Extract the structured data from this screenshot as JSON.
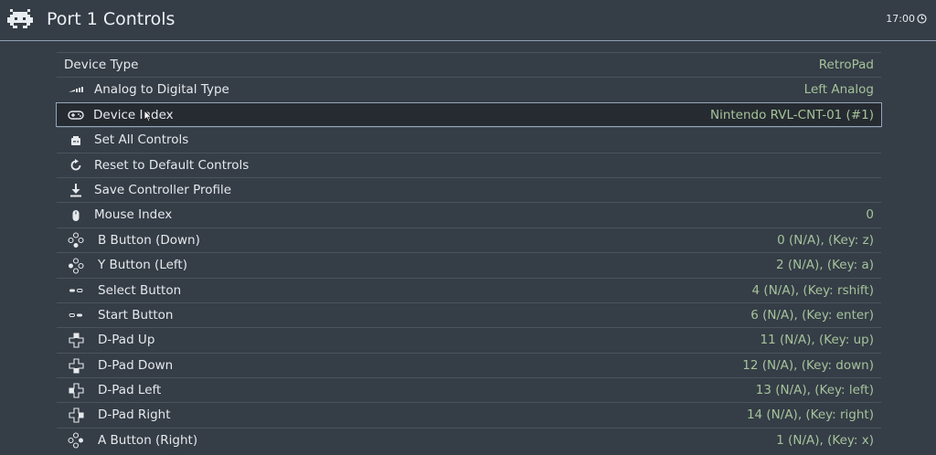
{
  "header": {
    "title": "Port 1 Controls",
    "time": "17:00",
    "logo_icon": "retroarch-invader-icon",
    "clock_icon": "clock-icon"
  },
  "colors": {
    "background": "#353d47",
    "selected_background": "#262b31",
    "selected_border": "#93a6bb",
    "value_text": "#a5c39a",
    "label_text": "#e6e9ec"
  },
  "menu": {
    "items": [
      {
        "label": "Device Type",
        "value": "RetroPad",
        "icon": "none"
      },
      {
        "label": "Analog to Digital Type",
        "value": "Left Analog",
        "icon": "analog-stick-icon"
      },
      {
        "label": "Device Index",
        "value": "Nintendo RVL-CNT-01 (#1)",
        "icon": "gamepad-icon",
        "selected": true
      },
      {
        "label": "Set All Controls",
        "value": "",
        "icon": "gamepad-set-icon"
      },
      {
        "label": "Reset to Default Controls",
        "value": "",
        "icon": "reset-icon"
      },
      {
        "label": "Save Controller Profile",
        "value": "",
        "icon": "download-icon"
      },
      {
        "label": "Mouse Index",
        "value": "0",
        "icon": "mouse-icon"
      },
      {
        "label": "B Button (Down)",
        "value": "0 (N/A), (Key: z)",
        "icon": "face-buttons-down-icon"
      },
      {
        "label": "Y Button (Left)",
        "value": "2 (N/A), (Key: a)",
        "icon": "face-buttons-left-icon"
      },
      {
        "label": "Select Button",
        "value": "4 (N/A), (Key: rshift)",
        "icon": "select-button-icon"
      },
      {
        "label": "Start Button",
        "value": "6 (N/A), (Key: enter)",
        "icon": "start-button-icon"
      },
      {
        "label": "D-Pad Up",
        "value": "11 (N/A), (Key: up)",
        "icon": "dpad-up-icon"
      },
      {
        "label": "D-Pad Down",
        "value": "12 (N/A), (Key: down)",
        "icon": "dpad-down-icon"
      },
      {
        "label": "D-Pad Left",
        "value": "13 (N/A), (Key: left)",
        "icon": "dpad-left-icon"
      },
      {
        "label": "D-Pad Right",
        "value": "14 (N/A), (Key: right)",
        "icon": "dpad-right-icon"
      },
      {
        "label": "A Button (Right)",
        "value": "1 (N/A), (Key: x)",
        "icon": "face-buttons-right-icon"
      }
    ]
  }
}
